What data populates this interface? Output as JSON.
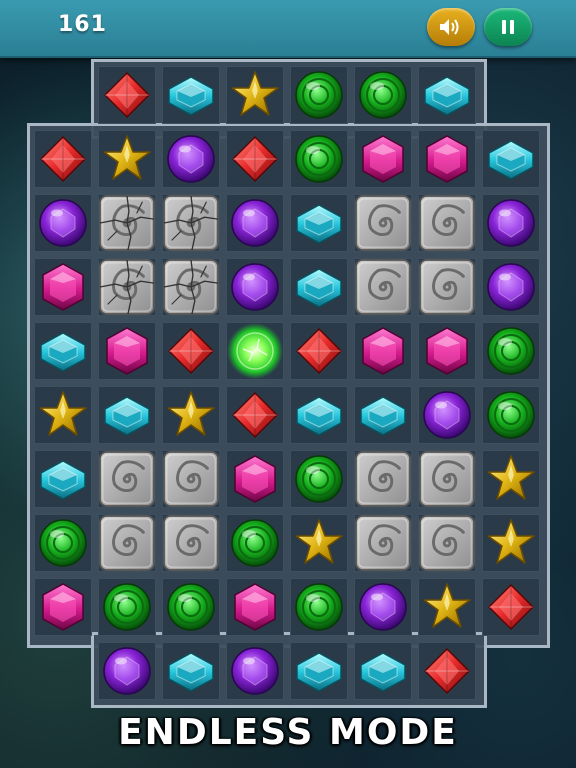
{
  "header": {
    "score": "161",
    "sound_icon": "speaker-icon",
    "pause_icon": "pause-icon",
    "colors": {
      "bar": "#3a9bb0",
      "sound_button": "#e8b120",
      "pause_button": "#1bb879"
    }
  },
  "footer": {
    "mode_label": "ENDLESS MODE"
  },
  "legend": {
    "R": "red-diamond-gem",
    "C": "cyan-rectangle-gem",
    "Y": "yellow-star-gem",
    "G": "green-round-gem",
    "P": "pink-hexagon-gem",
    "V": "purple-sphere-gem",
    "S": "stone-block",
    "K": "cracked-stone-block",
    "B": "glowing-green-bomb",
    "-": "empty-space"
  },
  "board": [
    "-RCYGGC-",
    "RYVRGPPC",
    "VKKVCSSV",
    "PKKVCSSV",
    "CPRBRPPG",
    "YCYRCCVG",
    "CSSPGSSY",
    "GSSGYSSY",
    "PGGPGVYR",
    "-VCVCCR-"
  ]
}
